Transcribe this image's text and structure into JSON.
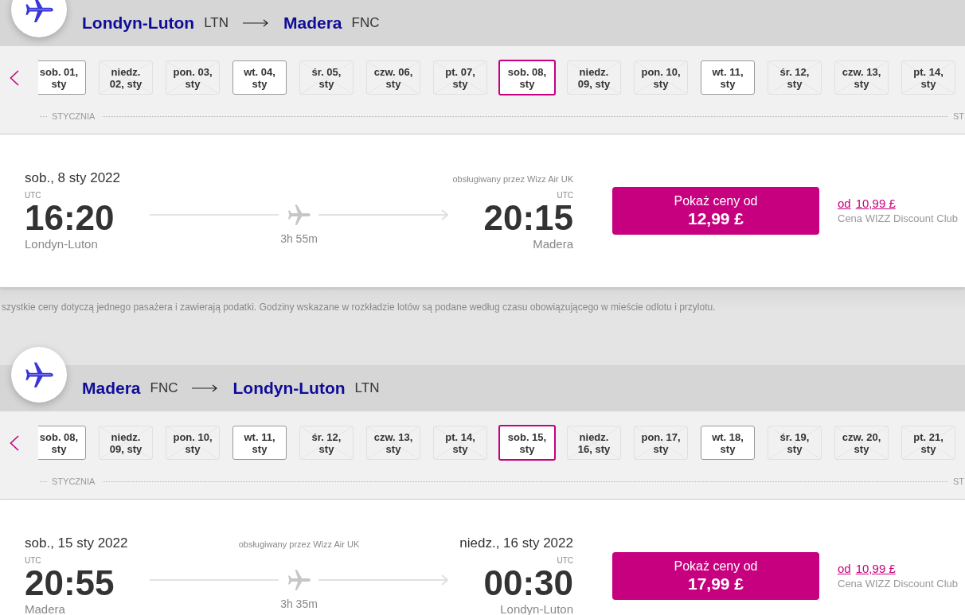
{
  "outbound": {
    "route": {
      "from": {
        "city": "Londyn-Luton",
        "code": "LTN"
      },
      "to": {
        "city": "Madera",
        "code": "FNC"
      }
    },
    "dates": [
      {
        "lines": [
          "sob. 01,",
          "sty"
        ],
        "available": true,
        "selected": false
      },
      {
        "lines": [
          "niedz.",
          "02, sty"
        ],
        "available": false,
        "selected": false
      },
      {
        "lines": [
          "pon. 03,",
          "sty"
        ],
        "available": false,
        "selected": false
      },
      {
        "lines": [
          "wt. 04,",
          "sty"
        ],
        "available": true,
        "selected": false
      },
      {
        "lines": [
          "śr. 05,",
          "sty"
        ],
        "available": false,
        "selected": false
      },
      {
        "lines": [
          "czw. 06,",
          "sty"
        ],
        "available": false,
        "selected": false
      },
      {
        "lines": [
          "pt. 07,",
          "sty"
        ],
        "available": false,
        "selected": false
      },
      {
        "lines": [
          "sob. 08,",
          "sty"
        ],
        "available": true,
        "selected": true
      },
      {
        "lines": [
          "niedz.",
          "09, sty"
        ],
        "available": false,
        "selected": false
      },
      {
        "lines": [
          "pon. 10,",
          "sty"
        ],
        "available": false,
        "selected": false
      },
      {
        "lines": [
          "wt. 11,",
          "sty"
        ],
        "available": true,
        "selected": false
      },
      {
        "lines": [
          "śr. 12,",
          "sty"
        ],
        "available": false,
        "selected": false
      },
      {
        "lines": [
          "czw. 13,",
          "sty"
        ],
        "available": false,
        "selected": false
      },
      {
        "lines": [
          "pt. 14,",
          "sty"
        ],
        "available": false,
        "selected": false
      }
    ],
    "month_labels": [
      "STYCZNIA",
      "ST"
    ],
    "flight": {
      "departure": {
        "date": "sob., 8 sty 2022",
        "timezone": "UTC",
        "time": "16:20",
        "city": "Londyn-Luton"
      },
      "duration": "3h 55m",
      "operator": "obsługiwany przez Wizz Air UK",
      "arrival": {
        "timezone": "UTC",
        "time": "20:15",
        "city": "Madera"
      },
      "price_button": {
        "label": "Pokaż ceny od",
        "price": "12,99 £"
      },
      "club": {
        "prefix": "od",
        "price": "10,99 £",
        "label": "Cena WIZZ Discount Club"
      }
    }
  },
  "note": "szystkie ceny dotyczą jednego pasażera i zawierają podatki. Godziny wskazane w rozkładzie lotów są podane według czasu obowiązującego w mieście odlotu i przylotu.",
  "return": {
    "route": {
      "from": {
        "city": "Madera",
        "code": "FNC"
      },
      "to": {
        "city": "Londyn-Luton",
        "code": "LTN"
      }
    },
    "dates": [
      {
        "lines": [
          "sob. 08,",
          "sty"
        ],
        "available": true,
        "selected": false
      },
      {
        "lines": [
          "niedz.",
          "09, sty"
        ],
        "available": false,
        "selected": false
      },
      {
        "lines": [
          "pon. 10,",
          "sty"
        ],
        "available": false,
        "selected": false
      },
      {
        "lines": [
          "wt. 11,",
          "sty"
        ],
        "available": true,
        "selected": false
      },
      {
        "lines": [
          "śr. 12,",
          "sty"
        ],
        "available": false,
        "selected": false
      },
      {
        "lines": [
          "czw. 13,",
          "sty"
        ],
        "available": false,
        "selected": false
      },
      {
        "lines": [
          "pt. 14,",
          "sty"
        ],
        "available": false,
        "selected": false
      },
      {
        "lines": [
          "sob. 15,",
          "sty"
        ],
        "available": true,
        "selected": true
      },
      {
        "lines": [
          "niedz.",
          "16, sty"
        ],
        "available": false,
        "selected": false
      },
      {
        "lines": [
          "pon. 17,",
          "sty"
        ],
        "available": false,
        "selected": false
      },
      {
        "lines": [
          "wt. 18,",
          "sty"
        ],
        "available": true,
        "selected": false
      },
      {
        "lines": [
          "śr. 19,",
          "sty"
        ],
        "available": false,
        "selected": false
      },
      {
        "lines": [
          "czw. 20,",
          "sty"
        ],
        "available": false,
        "selected": false
      },
      {
        "lines": [
          "pt. 21,",
          "sty"
        ],
        "available": false,
        "selected": false
      }
    ],
    "month_labels": [
      "STYCZNIA",
      "ST"
    ],
    "flight": {
      "departure": {
        "date": "sob., 15 sty 2022",
        "timezone": "UTC",
        "time": "20:55",
        "city": "Madera"
      },
      "duration": "3h 35m",
      "operator": "obsługiwany przez Wizz Air UK",
      "arrival": {
        "date": "niedz., 16 sty 2022",
        "timezone": "UTC",
        "time": "00:30",
        "city": "Londyn-Luton"
      },
      "price_button": {
        "label": "Pokaż ceny od",
        "price": "17,99 £"
      },
      "club": {
        "prefix": "od",
        "price": "10,99 £",
        "label": "Cena WIZZ Discount Club"
      }
    }
  }
}
